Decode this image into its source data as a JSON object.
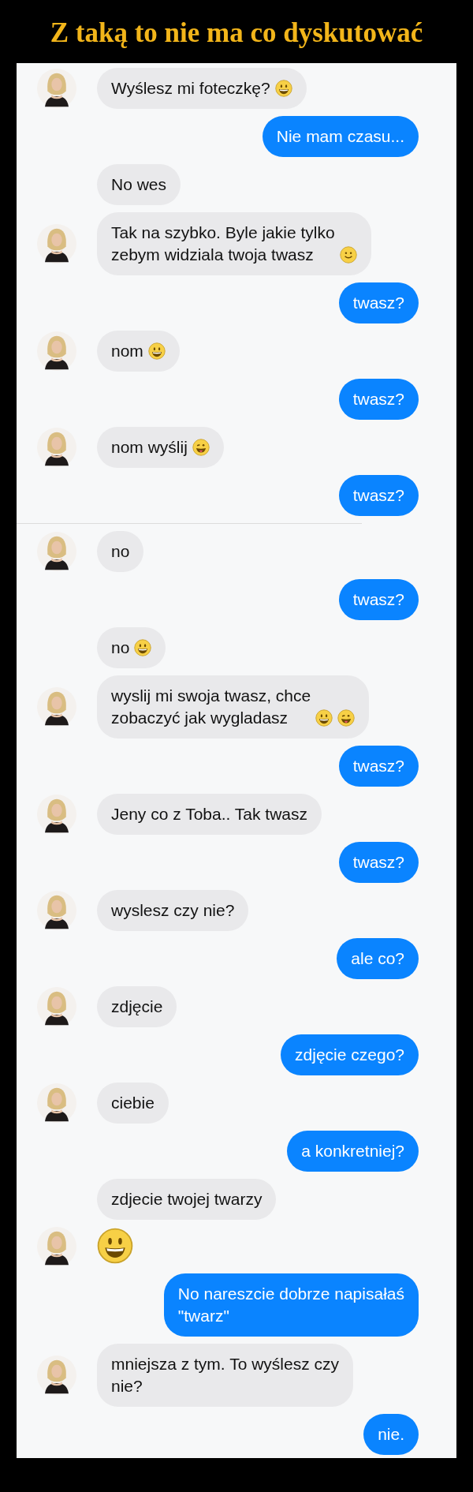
{
  "title": "Z taką to nie ma co dyskutować",
  "messages": [
    {
      "outgoing": false,
      "avatar": true,
      "text": "Wyślesz mi foteczkę?",
      "emoji": [
        {
          "kind": "grin"
        }
      ]
    },
    {
      "outgoing": true,
      "text": "Nie mam czasu..."
    },
    {
      "outgoing": false,
      "avatar": false,
      "text": "No wes"
    },
    {
      "outgoing": false,
      "avatar": true,
      "text": "Tak na szybko. Byle jakie tylko\nzebym widziala twoja twasz",
      "emoji": [
        {
          "kind": "smile"
        }
      ]
    },
    {
      "outgoing": true,
      "text": "twasz?"
    },
    {
      "outgoing": false,
      "avatar": true,
      "text": "nom",
      "emoji": [
        {
          "kind": "grin"
        }
      ]
    },
    {
      "outgoing": true,
      "text": "twasz?"
    },
    {
      "outgoing": false,
      "avatar": true,
      "text": "nom wyślij",
      "emoji": [
        {
          "kind": "tongue"
        }
      ]
    },
    {
      "outgoing": true,
      "text": "twasz?",
      "divider_after": true
    },
    {
      "outgoing": false,
      "avatar": true,
      "text": "no"
    },
    {
      "outgoing": true,
      "text": "twasz?"
    },
    {
      "outgoing": false,
      "avatar": false,
      "text": "no",
      "emoji": [
        {
          "kind": "grin"
        }
      ]
    },
    {
      "outgoing": false,
      "avatar": true,
      "text": "wyslij mi swoja twasz, chce\nzobaczyć jak wygladasz",
      "emoji": [
        {
          "kind": "grin"
        },
        {
          "kind": "tongue"
        }
      ]
    },
    {
      "outgoing": true,
      "text": "twasz?"
    },
    {
      "outgoing": false,
      "avatar": true,
      "text": "Jeny co z Toba.. Tak twasz"
    },
    {
      "outgoing": true,
      "text": "twasz?"
    },
    {
      "outgoing": false,
      "avatar": true,
      "text": "wyslesz czy nie?"
    },
    {
      "outgoing": true,
      "text": "ale co?"
    },
    {
      "outgoing": false,
      "avatar": true,
      "text": "zdjęcie"
    },
    {
      "outgoing": true,
      "text": "zdjęcie czego?"
    },
    {
      "outgoing": false,
      "avatar": true,
      "text": "ciebie"
    },
    {
      "outgoing": true,
      "text": "a konkretniej?"
    },
    {
      "outgoing": false,
      "avatar": false,
      "text": "zdjecie twojej twarzy"
    },
    {
      "outgoing": false,
      "avatar": true,
      "emoji": [
        {
          "kind": "big_grin"
        }
      ]
    },
    {
      "outgoing": true,
      "text": "No nareszcie dobrze napisałaś\n\"twarz\""
    },
    {
      "outgoing": false,
      "avatar": true,
      "text": "mniejsza z tym. To wyślesz czy\nnie?"
    },
    {
      "outgoing": true,
      "text": "nie."
    }
  ]
}
